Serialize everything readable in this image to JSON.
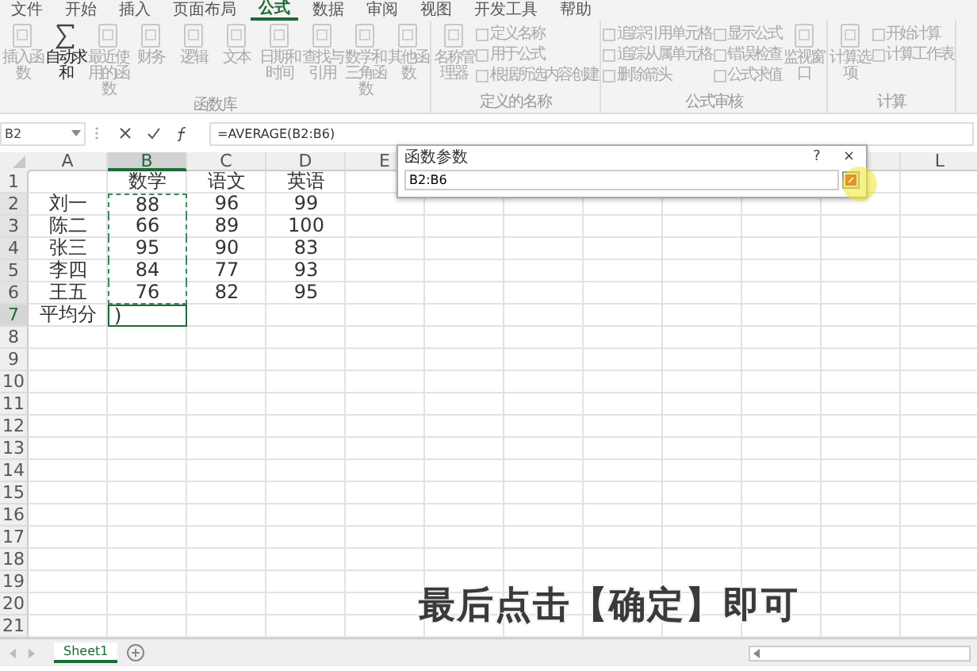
{
  "ribbon": {
    "tabs": [
      {
        "label": "文件",
        "selected": false
      },
      {
        "label": "开始",
        "selected": false
      },
      {
        "label": "插入",
        "selected": false
      },
      {
        "label": "页面布局",
        "selected": false
      },
      {
        "label": "公式",
        "selected": true
      },
      {
        "label": "数据",
        "selected": false
      },
      {
        "label": "审阅",
        "selected": false
      },
      {
        "label": "视图",
        "selected": false
      },
      {
        "label": "开发工具",
        "selected": false
      },
      {
        "label": "帮助",
        "selected": false
      }
    ],
    "groups": [
      {
        "label": "函数库",
        "items": [
          {
            "kind": "large",
            "label": "插入函数",
            "disabled": true
          },
          {
            "kind": "large",
            "label": "自动求和",
            "disabled": false
          },
          {
            "kind": "large",
            "label": "最近使用的函数",
            "disabled": true
          },
          {
            "kind": "large",
            "label": "财务",
            "disabled": true
          },
          {
            "kind": "large",
            "label": "逻辑",
            "disabled": true
          },
          {
            "kind": "large",
            "label": "文本",
            "disabled": true
          },
          {
            "kind": "large",
            "label": "日期和时间",
            "disabled": true
          },
          {
            "kind": "large",
            "label": "查找与引用",
            "disabled": true
          },
          {
            "kind": "large",
            "label": "数学和三角函数",
            "disabled": true
          },
          {
            "kind": "large",
            "label": "其他函数",
            "disabled": true
          }
        ]
      },
      {
        "label": "定义的名称",
        "items": [
          {
            "kind": "large",
            "label": "名称管理器",
            "disabled": true
          },
          {
            "kind": "small",
            "label": "定义名称",
            "disabled": true
          },
          {
            "kind": "small",
            "label": "用于公式",
            "disabled": true
          },
          {
            "kind": "small",
            "label": "根据所选内容创建",
            "disabled": true
          }
        ]
      },
      {
        "label": "公式审核",
        "items": [
          {
            "kind": "small",
            "label": "追踪引用单元格",
            "disabled": true
          },
          {
            "kind": "small",
            "label": "追踪从属单元格",
            "disabled": true
          },
          {
            "kind": "small",
            "label": "删除箭头",
            "disabled": true
          },
          {
            "kind": "small",
            "label": "显示公式",
            "disabled": true
          },
          {
            "kind": "small",
            "label": "错误检查",
            "disabled": true
          },
          {
            "kind": "small",
            "label": "公式求值",
            "disabled": true
          },
          {
            "kind": "large",
            "label": "监视窗口",
            "disabled": true
          }
        ]
      },
      {
        "label": "计算",
        "items": [
          {
            "kind": "large",
            "label": "计算选项",
            "disabled": true
          },
          {
            "kind": "small",
            "label": "开始计算",
            "disabled": true
          },
          {
            "kind": "small",
            "label": "计算工作表",
            "disabled": true
          }
        ]
      }
    ]
  },
  "formula_bar": {
    "name_box": "B2",
    "formula": "=AVERAGE(B2:B6)"
  },
  "sheet": {
    "columns": [
      {
        "label": "A",
        "selected": false
      },
      {
        "label": "B",
        "selected": true
      },
      {
        "label": "C",
        "selected": false
      },
      {
        "label": "D",
        "selected": false
      },
      {
        "label": "E",
        "selected": false
      },
      {
        "label": "L",
        "selected": false
      }
    ],
    "rows": [
      {
        "label": "1",
        "cells": [
          "",
          "数学",
          "语文",
          "英语"
        ],
        "referenced": false,
        "editing": false
      },
      {
        "label": "2",
        "cells": [
          "刘一",
          "88",
          "96",
          "99"
        ],
        "referenced": true,
        "editing": false
      },
      {
        "label": "3",
        "cells": [
          "陈二",
          "66",
          "89",
          "100"
        ],
        "referenced": true,
        "editing": false
      },
      {
        "label": "4",
        "cells": [
          "张三",
          "95",
          "90",
          "83"
        ],
        "referenced": true,
        "editing": false
      },
      {
        "label": "5",
        "cells": [
          "李四",
          "84",
          "77",
          "93"
        ],
        "referenced": true,
        "editing": false
      },
      {
        "label": "6",
        "cells": [
          "王五",
          "76",
          "82",
          "95"
        ],
        "referenced": true,
        "editing": false
      },
      {
        "label": "7",
        "cells": [
          "平均分",
          ")"
        ],
        "referenced": false,
        "editing": true
      },
      {
        "label": "8",
        "cells": [],
        "referenced": false,
        "editing": false
      },
      {
        "label": "9",
        "cells": [],
        "referenced": false,
        "editing": false
      },
      {
        "label": "10",
        "cells": [],
        "referenced": false,
        "editing": false
      },
      {
        "label": "11",
        "cells": [],
        "referenced": false,
        "editing": false
      },
      {
        "label": "12",
        "cells": [],
        "referenced": false,
        "editing": false
      },
      {
        "label": "13",
        "cells": [],
        "referenced": false,
        "editing": false
      },
      {
        "label": "14",
        "cells": [],
        "referenced": false,
        "editing": false
      },
      {
        "label": "15",
        "cells": [],
        "referenced": false,
        "editing": false
      },
      {
        "label": "16",
        "cells": [],
        "referenced": false,
        "editing": false
      },
      {
        "label": "17",
        "cells": [],
        "referenced": false,
        "editing": false
      },
      {
        "label": "18",
        "cells": [],
        "referenced": false,
        "editing": false
      },
      {
        "label": "19",
        "cells": [],
        "referenced": false,
        "editing": false
      },
      {
        "label": "20",
        "cells": [],
        "referenced": false,
        "editing": false
      },
      {
        "label": "21",
        "cells": [],
        "referenced": false,
        "editing": false
      }
    ],
    "sheet_tabs": [
      {
        "label": "Sheet1",
        "selected": true
      }
    ]
  },
  "dialog": {
    "title": "函数参数",
    "help": "?",
    "close": "×",
    "value": "B2:B6"
  },
  "caption": "最后点击【确定】即可"
}
